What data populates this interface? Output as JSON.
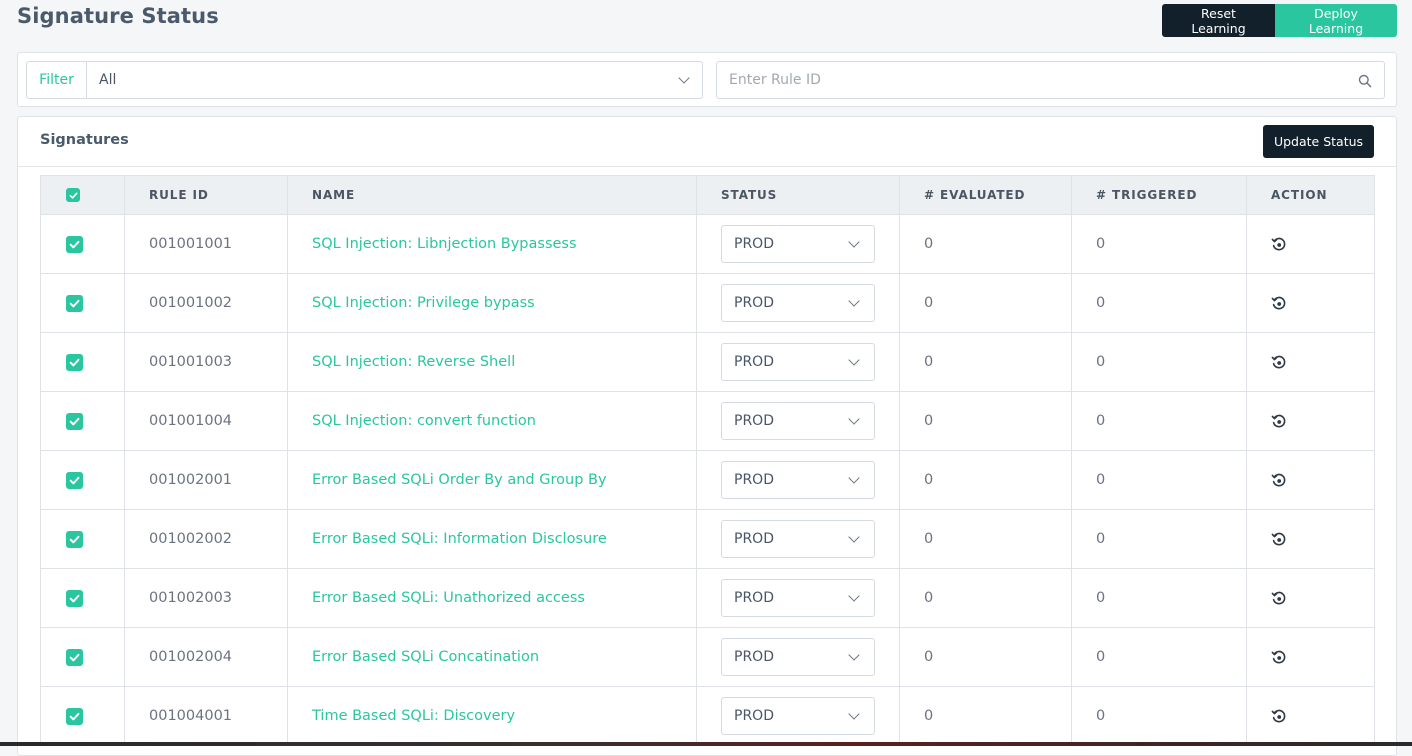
{
  "page": {
    "title": "Signature Status"
  },
  "toolbar": {
    "reset_label": "Reset Learning",
    "deploy_label": "Deploy Learning"
  },
  "filter": {
    "label": "Filter",
    "selected": "All",
    "search_placeholder": "Enter Rule ID"
  },
  "signatures": {
    "title": "Signatures",
    "update_label": "Update Status",
    "columns": [
      "RULE ID",
      "NAME",
      "STATUS",
      "# EVALUATED",
      "# TRIGGERED",
      "ACTION"
    ],
    "rows": [
      {
        "rule_id": "001001001",
        "name": "SQL Injection: Libnjection Bypassess",
        "status": "PROD",
        "evaluated": "0",
        "triggered": "0"
      },
      {
        "rule_id": "001001002",
        "name": "SQL Injection: Privilege bypass",
        "status": "PROD",
        "evaluated": "0",
        "triggered": "0"
      },
      {
        "rule_id": "001001003",
        "name": "SQL Injection: Reverse Shell",
        "status": "PROD",
        "evaluated": "0",
        "triggered": "0"
      },
      {
        "rule_id": "001001004",
        "name": "SQL Injection: convert function",
        "status": "PROD",
        "evaluated": "0",
        "triggered": "0"
      },
      {
        "rule_id": "001002001",
        "name": "Error Based SQLi Order By and Group By",
        "status": "PROD",
        "evaluated": "0",
        "triggered": "0"
      },
      {
        "rule_id": "001002002",
        "name": "Error Based SQLi: Information Disclosure",
        "status": "PROD",
        "evaluated": "0",
        "triggered": "0"
      },
      {
        "rule_id": "001002003",
        "name": "Error Based SQLi: Unathorized access",
        "status": "PROD",
        "evaluated": "0",
        "triggered": "0"
      },
      {
        "rule_id": "001002004",
        "name": "Error Based SQLi Concatination",
        "status": "PROD",
        "evaluated": "0",
        "triggered": "0"
      },
      {
        "rule_id": "001004001",
        "name": "Time Based SQLi: Discovery",
        "status": "PROD",
        "evaluated": "0",
        "triggered": "0"
      }
    ]
  },
  "colors": {
    "accent": "#2ac6a0",
    "dark": "#12202b"
  },
  "icons": {
    "search": "search-icon",
    "reset": "reset-icon",
    "checkbox": "checkbox-checked-icon"
  }
}
